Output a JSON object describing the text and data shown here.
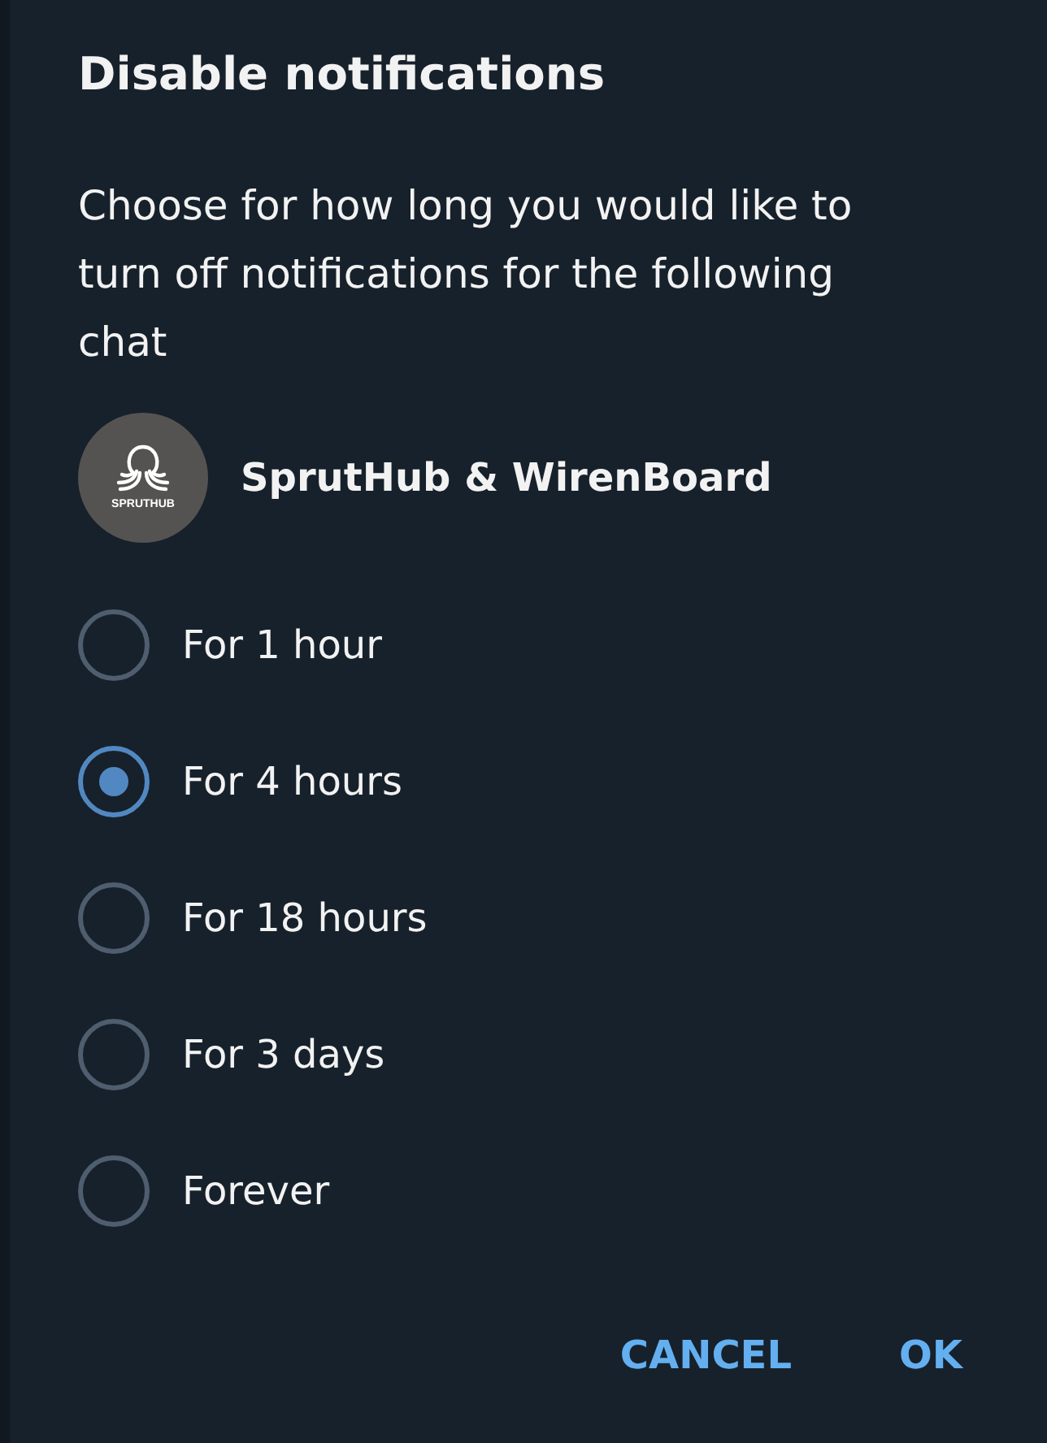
{
  "dialog": {
    "title": "Disable notifications",
    "description": "Choose for how long you would like to turn off notifications for the following chat"
  },
  "chat": {
    "avatar_label": "SPRUTHUB",
    "name": "SprutHub & WirenBoard"
  },
  "options": [
    {
      "label": "For 1 hour",
      "selected": false
    },
    {
      "label": "For 4 hours",
      "selected": true
    },
    {
      "label": "For 18 hours",
      "selected": false
    },
    {
      "label": "For 3 days",
      "selected": false
    },
    {
      "label": "Forever",
      "selected": false
    }
  ],
  "buttons": [
    "CANCEL",
    "OK"
  ]
}
